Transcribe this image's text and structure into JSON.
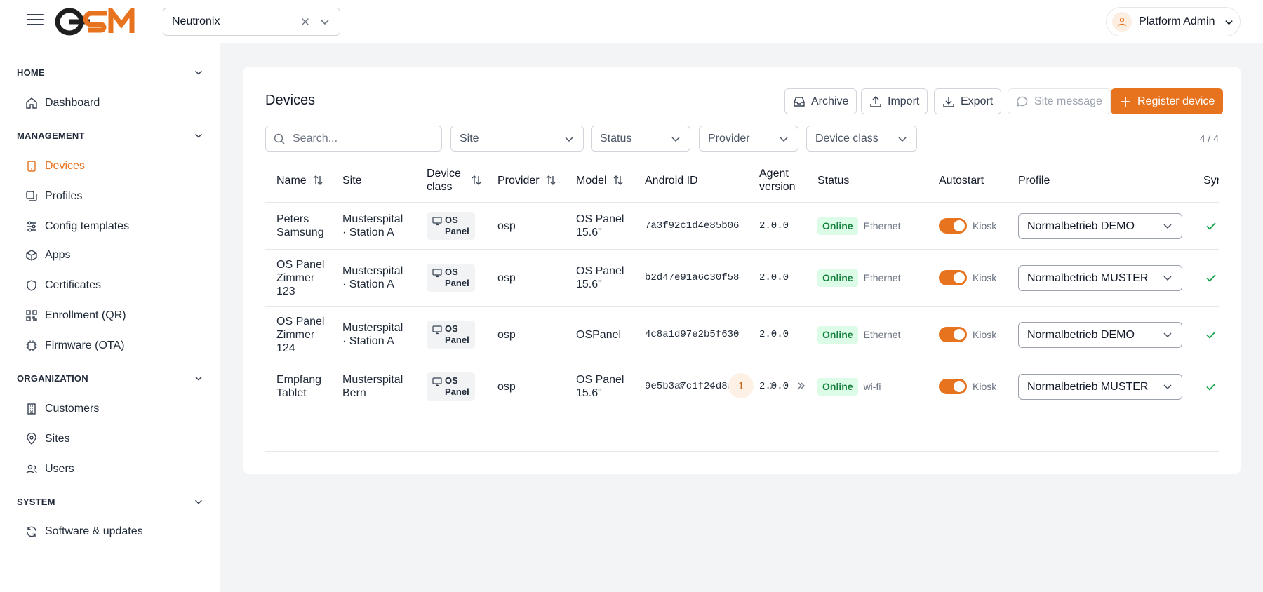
{
  "header": {
    "logo_text": "OSM",
    "tenant": {
      "value": "Neutronix"
    },
    "user": {
      "name": "Platform Admin"
    }
  },
  "sidebar": {
    "sections": [
      {
        "title": "HOME",
        "items": [
          {
            "label": "Dashboard",
            "icon": "home-icon"
          }
        ]
      },
      {
        "title": "MANAGEMENT",
        "items": [
          {
            "label": "Devices",
            "icon": "tablet-icon",
            "active": true
          },
          {
            "label": "Profiles",
            "icon": "copy-icon"
          },
          {
            "label": "Config templates",
            "icon": "sliders-icon"
          },
          {
            "label": "Apps",
            "icon": "box-icon"
          },
          {
            "label": "Certificates",
            "icon": "shield-icon"
          },
          {
            "label": "Enrollment (QR)",
            "icon": "qr-icon"
          },
          {
            "label": "Firmware (OTA)",
            "icon": "chip-icon"
          }
        ]
      },
      {
        "title": "ORGANIZATION",
        "items": [
          {
            "label": "Customers",
            "icon": "building-icon"
          },
          {
            "label": "Sites",
            "icon": "map-pin-icon"
          },
          {
            "label": "Users",
            "icon": "users-icon"
          }
        ]
      },
      {
        "title": "SYSTEM",
        "items": [
          {
            "label": "Software & updates",
            "icon": "refresh-icon"
          }
        ]
      }
    ]
  },
  "page": {
    "title": "Devices",
    "toolbar": {
      "archive": "Archive",
      "import": "Import",
      "export": "Export",
      "site_message": "Site message",
      "register": "Register device"
    },
    "search_placeholder": "Search...",
    "filters": {
      "site": "Site",
      "status": "Status",
      "provider": "Provider",
      "device_class": "Device class"
    },
    "count": "4 / 4",
    "columns": {
      "name": "Name",
      "site": "Site",
      "device_class_l1": "Device",
      "device_class_l2": "class",
      "provider": "Provider",
      "model": "Model",
      "android_id": "Android ID",
      "agent_l1": "Agent",
      "agent_l2": "version",
      "status": "Status",
      "autostart": "Autostart",
      "profile": "Profile",
      "sync": "Syn"
    },
    "rows": [
      {
        "name_l1": "Peters",
        "name_l2": "Samsung",
        "name_l3": "",
        "site_l1": "Musterspital",
        "site_l2": "· Station A",
        "dc_l1": "OS",
        "dc_l2": "Panel",
        "provider": "osp",
        "model_l1": "OS Panel",
        "model_l2": "15.6\"",
        "android_id": "7a3f92c1d4e85b06",
        "agent": "2.0.0",
        "status": "Online",
        "conn": "Ethernet",
        "autostart": true,
        "kiosk": "Kiosk",
        "profile": "Normalbetrieb DEMO"
      },
      {
        "name_l1": "OS Panel",
        "name_l2": "Zimmer",
        "name_l3": "123",
        "site_l1": "Musterspital",
        "site_l2": "· Station A",
        "dc_l1": "OS",
        "dc_l2": "Panel",
        "provider": "osp",
        "model_l1": "OS Panel",
        "model_l2": "15.6\"",
        "android_id": "b2d47e91a6c30f58",
        "agent": "2.0.0",
        "status": "Online",
        "conn": "Ethernet",
        "autostart": true,
        "kiosk": "Kiosk",
        "profile": "Normalbetrieb MUSTER"
      },
      {
        "name_l1": "OS Panel",
        "name_l2": "Zimmer",
        "name_l3": "124",
        "site_l1": "Musterspital",
        "site_l2": "· Station A",
        "dc_l1": "OS",
        "dc_l2": "Panel",
        "provider": "osp",
        "model_l1": "OSPanel",
        "model_l2": "",
        "android_id": "4c8a1d97e2b5f630",
        "agent": "2.0.0",
        "status": "Online",
        "conn": "Ethernet",
        "autostart": true,
        "kiosk": "Kiosk",
        "profile": "Normalbetrieb DEMO"
      },
      {
        "name_l1": "Empfang",
        "name_l2": "Tablet",
        "name_l3": "",
        "site_l1": "Musterspital",
        "site_l2": "Bern",
        "dc_l1": "OS",
        "dc_l2": "Panel",
        "provider": "osp",
        "model_l1": "OS Panel",
        "model_l2": "15.6\"",
        "android_id": "9e5b3a7c1f24d8a6",
        "agent": "2.0.0",
        "status": "Online",
        "conn": "wi-fi",
        "autostart": true,
        "kiosk": "Kiosk",
        "profile": "Normalbetrieb MUSTER"
      }
    ],
    "pagination": {
      "current": "1"
    }
  }
}
